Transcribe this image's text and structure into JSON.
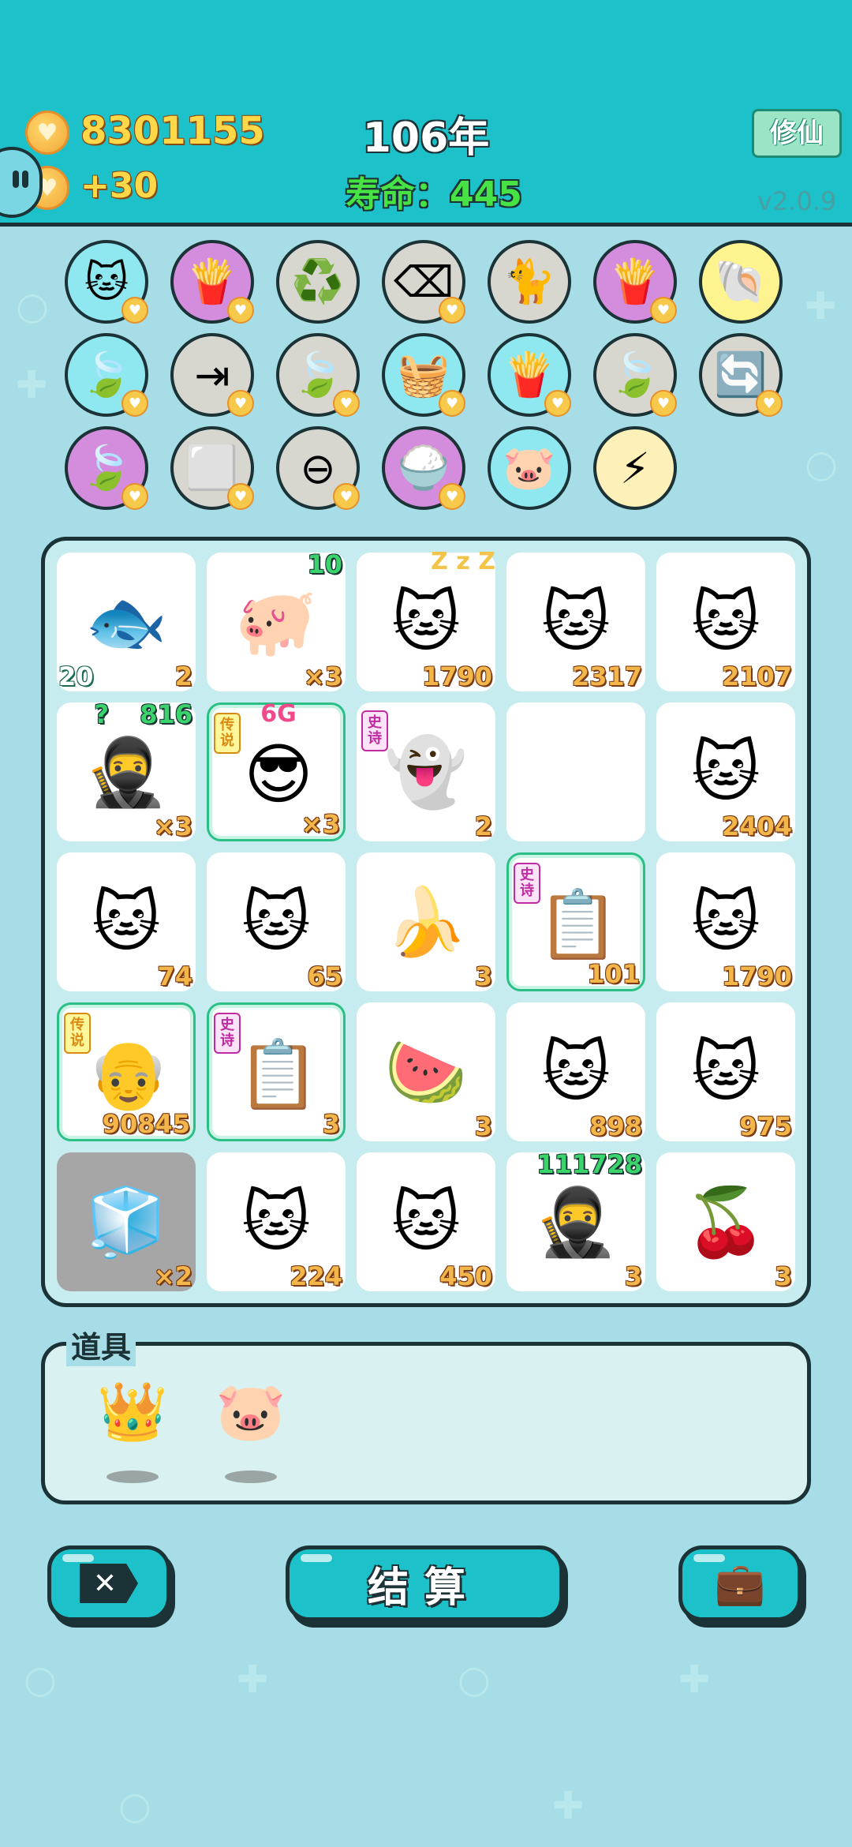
{
  "header": {
    "coins": "8301155",
    "income": "+30",
    "year": "106年",
    "life": "寿命：445",
    "cultivate_button": "修仙",
    "version": "v2.0.9"
  },
  "relics": [
    {
      "icon": "cat-dark-icon",
      "glyph": "🐱",
      "bg": "#8fe7f0",
      "mini": true
    },
    {
      "icon": "fries-icon",
      "glyph": "🍟",
      "bg": "#d48ddc",
      "mini": true
    },
    {
      "icon": "recycle-icon",
      "glyph": "♻️",
      "bg": "#d7d7d0",
      "mini": false
    },
    {
      "icon": "remove-tag-icon",
      "glyph": "⌫",
      "bg": "#d7d7d0",
      "mini": true
    },
    {
      "icon": "cats-pair-icon",
      "glyph": "🐈",
      "bg": "#d7d7d0",
      "mini": false
    },
    {
      "icon": "fries-icon",
      "glyph": "🍟",
      "bg": "#d48ddc",
      "mini": true
    },
    {
      "icon": "shell-icon",
      "glyph": "🐚",
      "bg": "#fdf38f",
      "mini": false
    },
    {
      "icon": "leaf-icon",
      "glyph": "🍃",
      "bg": "#8fe7f0",
      "mini": true
    },
    {
      "icon": "skip-icon",
      "glyph": "⇥",
      "bg": "#d7d7d0",
      "mini": true
    },
    {
      "icon": "leaf-icon",
      "glyph": "🍃",
      "bg": "#d7d7d0",
      "mini": true
    },
    {
      "icon": "fruit-basket-icon",
      "glyph": "🧺",
      "bg": "#8fe7f0",
      "mini": true
    },
    {
      "icon": "fries-icon",
      "glyph": "🍟",
      "bg": "#8fe7f0",
      "mini": true
    },
    {
      "icon": "leaf-icon",
      "glyph": "🍃",
      "bg": "#d7d7d0",
      "mini": true
    },
    {
      "icon": "refresh-icon",
      "glyph": "🔄",
      "bg": "#d7d7d0",
      "mini": true
    },
    {
      "icon": "leaf-icon",
      "glyph": "🍃",
      "bg": "#d48ddc",
      "mini": true
    },
    {
      "icon": "sugar-cubes-icon",
      "glyph": "⬜",
      "bg": "#d7d7d0",
      "mini": true
    },
    {
      "icon": "minus-circle-icon",
      "glyph": "⊖",
      "bg": "#d7d7d0",
      "mini": true
    },
    {
      "icon": "rice-bowl-icon",
      "glyph": "🍚",
      "bg": "#d48ddc",
      "mini": true
    },
    {
      "icon": "piggy-bank-icon",
      "glyph": "🐷",
      "bg": "#8fe7f0",
      "mini": false
    },
    {
      "icon": "lightning-icon",
      "glyph": "⚡",
      "bg": "#fdf0b8",
      "mini": false
    }
  ],
  "board": [
    {
      "name": "fish",
      "glyph": "🐟",
      "num": "2",
      "tl": "20"
    },
    {
      "name": "pig",
      "glyph": "🐖",
      "num": "×3",
      "tr": "10"
    },
    {
      "name": "cat-sleeping",
      "glyph": "🐱",
      "num": "1790",
      "zzz": "Z z Z"
    },
    {
      "name": "cat",
      "glyph": "🐱",
      "num": "2317"
    },
    {
      "name": "cat",
      "glyph": "🐱",
      "num": "2107"
    },
    {
      "name": "thief",
      "glyph": "🥷",
      "num": "×3",
      "tr": "816",
      "q": "?"
    },
    {
      "name": "boss-king",
      "glyph": "😎",
      "num": "×3",
      "special": true,
      "badge": "传说",
      "badge_type": "leg",
      "topc": "6G"
    },
    {
      "name": "ghost",
      "glyph": "👻",
      "num": "2",
      "badge": "史诗",
      "badge_type": "epic"
    },
    {
      "name": "empty",
      "glyph": "",
      "num": ""
    },
    {
      "name": "cat",
      "glyph": "🐱",
      "num": "2404"
    },
    {
      "name": "cat",
      "glyph": "🐱",
      "num": "74"
    },
    {
      "name": "cat",
      "glyph": "🐱",
      "num": "65"
    },
    {
      "name": "banana",
      "glyph": "🍌",
      "num": "3"
    },
    {
      "name": "copy-paste",
      "glyph": "📋",
      "num": "101",
      "special": true,
      "badge": "史诗",
      "badge_type": "epic"
    },
    {
      "name": "cat",
      "glyph": "🐱",
      "num": "1790"
    },
    {
      "name": "old-king",
      "glyph": "👴",
      "num": "90845",
      "special": true,
      "badge": "传说",
      "badge_type": "leg"
    },
    {
      "name": "copy-paste",
      "glyph": "📋",
      "num": "3",
      "special": true,
      "badge": "史诗",
      "badge_type": "epic"
    },
    {
      "name": "watermelon",
      "glyph": "🍉",
      "num": "3"
    },
    {
      "name": "cat",
      "glyph": "🐱",
      "num": "898"
    },
    {
      "name": "cat",
      "glyph": "🐱",
      "num": "975"
    },
    {
      "name": "fridge",
      "glyph": "🧊",
      "num": "×2",
      "gray": true
    },
    {
      "name": "cat",
      "glyph": "🐱",
      "num": "224"
    },
    {
      "name": "cat",
      "glyph": "🐱",
      "num": "450"
    },
    {
      "name": "thief",
      "glyph": "🥷",
      "num": "3",
      "tr": "111728"
    },
    {
      "name": "cherry",
      "glyph": "🍒",
      "num": "3"
    }
  ],
  "tools": {
    "label": "道具",
    "items": [
      {
        "icon": "crown-icon",
        "glyph": "👑"
      },
      {
        "icon": "piggy-bank-icon",
        "glyph": "🐷"
      }
    ]
  },
  "buttons": {
    "remove": "✕",
    "settle": "结算",
    "bag_icon": "💼"
  },
  "colors": {
    "header_bg": "#1cc1c9",
    "page_bg": "#a6dde6",
    "gold": "#ffd84a",
    "life_green": "#47e243"
  }
}
